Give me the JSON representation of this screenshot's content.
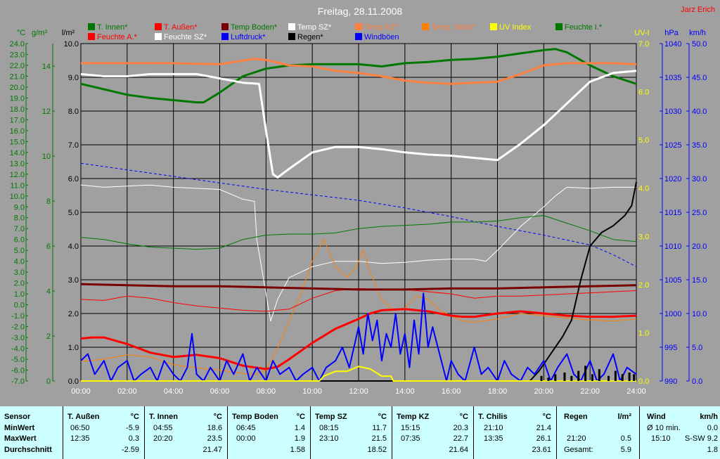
{
  "title": "Freitag, 28.11.2008",
  "author": "Jarz Erich",
  "legend": [
    {
      "label": "T. Innen*",
      "color": "#007800"
    },
    {
      "label": "T. Außen*",
      "color": "#ff0000"
    },
    {
      "label": "Temp Boden*",
      "color": "#780000"
    },
    {
      "label": "Temp SZ*",
      "color": "#ffffff"
    },
    {
      "label": "Temp KZ*",
      "color": "#ff8040"
    },
    {
      "label": "Temp. Wind*",
      "color": "#ff8000"
    },
    {
      "label": "UV Index",
      "color": "#ffff00"
    },
    {
      "label": "Feuchte I.*",
      "color": "#007800"
    },
    {
      "label": "Feuchte A.*",
      "color": "#ff0000"
    },
    {
      "label": "Feuchte SZ*",
      "color": "#ffffff"
    },
    {
      "label": "Luftdruck*",
      "color": "#0000ff"
    },
    {
      "label": "Regen*",
      "color": "#000000"
    },
    {
      "label": "Windböen",
      "color": "#0000ff"
    }
  ],
  "axis_units": {
    "temp": "°C",
    "hum": "g/m³",
    "rain": "l/m²",
    "uv": "UV-I",
    "pressure": "hPa",
    "wind": "km/h"
  },
  "chart_data": {
    "type": "line",
    "title": "Freitag, 28.11.2008",
    "x_ticks": [
      "00:00",
      "02:00",
      "04:00",
      "06:00",
      "08:00",
      "10:00",
      "12:00",
      "14:00",
      "16:00",
      "18:00",
      "20:00",
      "22:00",
      "24:00"
    ],
    "xlim": [
      0,
      24
    ],
    "axes": {
      "temp": {
        "ylim": [
          -7.0,
          24.0
        ],
        "ticks": [
          "24.0",
          "23.0",
          "22.0",
          "21.0",
          "20.0",
          "19.0",
          "18.0",
          "17.0",
          "16.0",
          "15.0",
          "14.0",
          "13.0",
          "12.0",
          "11.0",
          "10.0",
          "9.0",
          "8.0",
          "7.0",
          "6.0",
          "5.0",
          "4.0",
          "3.0",
          "2.0",
          "1.0",
          "0.0",
          "-1.0",
          "-2.0",
          "-3.0",
          "-4.0",
          "-5.0",
          "-6.0",
          "-7.0"
        ]
      },
      "humidity": {
        "ylim": [
          0,
          15
        ],
        "ticks": [
          "14",
          "12",
          "10",
          "8",
          "6",
          "4",
          "2",
          "0"
        ]
      },
      "rain": {
        "ylim": [
          0,
          10
        ],
        "ticks": [
          "10.0",
          "9.0",
          "8.0",
          "7.0",
          "6.0",
          "5.0",
          "4.0",
          "3.0",
          "2.0",
          "1.0",
          "0.0"
        ]
      },
      "uv": {
        "ylim": [
          0,
          7
        ],
        "ticks": [
          "7.0",
          "6.0",
          "5.0",
          "4.0",
          "3.0",
          "2.0",
          "1.0",
          "0.0"
        ]
      },
      "pressure": {
        "ylim": [
          990,
          1040
        ],
        "ticks": [
          "1040",
          "1035",
          "1030",
          "1025",
          "1020",
          "1015",
          "1010",
          "1005",
          "1000",
          "995",
          "990"
        ]
      },
      "wind": {
        "ylim": [
          0,
          50
        ],
        "ticks": [
          "50.0",
          "45.0",
          "40.0",
          "35.0",
          "30.0",
          "25.0",
          "20.0",
          "15.0",
          "10.0",
          "5.0",
          "0.0"
        ]
      }
    },
    "series": [
      {
        "name": "T. Innen*",
        "axis": "temp",
        "color": "#007800",
        "width": 3,
        "x": [
          0,
          1,
          2,
          3,
          4,
          5,
          5.3,
          6,
          7,
          8,
          9,
          10,
          11,
          12,
          13,
          14,
          15,
          16,
          17,
          18,
          19,
          20,
          20.5,
          21,
          22,
          23,
          24
        ],
        "y": [
          20.3,
          19.8,
          19.3,
          19.0,
          18.8,
          18.6,
          18.6,
          19.5,
          21.0,
          21.7,
          22.0,
          22.1,
          22.1,
          22.1,
          21.9,
          22.2,
          22.3,
          22.5,
          22.6,
          22.8,
          23.1,
          23.4,
          23.5,
          23.2,
          22.0,
          21.0,
          20.3
        ]
      },
      {
        "name": "Temp KZ*",
        "axis": "temp",
        "color": "#ff8040",
        "width": 3,
        "x": [
          0,
          2,
          4,
          6,
          7.5,
          8,
          9,
          10,
          11,
          12,
          13,
          14,
          15,
          16,
          17,
          18,
          19,
          20,
          21,
          22,
          23,
          24
        ],
        "y": [
          22.2,
          22.2,
          22.2,
          22.1,
          22.6,
          22.5,
          22.0,
          21.9,
          21.5,
          21.3,
          21.0,
          20.6,
          20.4,
          20.3,
          20.4,
          20.5,
          21.2,
          22.0,
          22.2,
          22.2,
          22.2,
          22.1
        ]
      },
      {
        "name": "Temp SZ*",
        "axis": "temp",
        "color": "#ffffff",
        "width": 3,
        "x": [
          0,
          1,
          2,
          3,
          4,
          5,
          6,
          7,
          7.7,
          8,
          8.3,
          8.5,
          9,
          10,
          11,
          12,
          13,
          14,
          15,
          16,
          17,
          18,
          19,
          20,
          21,
          22,
          23,
          24
        ],
        "y": [
          21.2,
          21.0,
          21.0,
          21.2,
          21.2,
          21.2,
          20.8,
          20.4,
          20.3,
          16.0,
          12.0,
          11.7,
          12.5,
          14.0,
          14.5,
          14.5,
          14.3,
          14.0,
          13.8,
          13.7,
          13.5,
          13.3,
          14.8,
          16.5,
          18.5,
          20.5,
          21.3,
          21.5
        ]
      },
      {
        "name": "Feuchte SZ*",
        "axis": "temp",
        "color": "#ffffff",
        "width": 1,
        "x": [
          0,
          1,
          2,
          3,
          4,
          5,
          6,
          7,
          7.5,
          7.6,
          8,
          8.2,
          8.5,
          9,
          10,
          11,
          12,
          13,
          14,
          15,
          16,
          17,
          17.5,
          18,
          19,
          20,
          20.5,
          21,
          22,
          23,
          24
        ],
        "y": [
          11.0,
          10.8,
          10.9,
          11.0,
          10.8,
          10.7,
          10.6,
          9.7,
          9.5,
          6.0,
          1.0,
          -1.5,
          0.5,
          2.5,
          3.5,
          4.0,
          4.0,
          3.8,
          3.9,
          4.1,
          4.2,
          4.2,
          4.0,
          5.0,
          7.2,
          9.0,
          10.0,
          10.8,
          10.7,
          10.8,
          10.8
        ]
      },
      {
        "name": "Luftdruck*",
        "axis": "temp",
        "color": "#0000ff",
        "width": 1,
        "dash": "4,3",
        "x": [
          0,
          2,
          4,
          6,
          8,
          10,
          12,
          14,
          16,
          18,
          20,
          22,
          23,
          24
        ],
        "y": [
          13.0,
          12.4,
          11.8,
          11.2,
          10.6,
          10.1,
          9.6,
          8.9,
          8.1,
          7.2,
          6.4,
          5.5,
          4.6,
          3.5
        ]
      },
      {
        "name": "Feuchte I.*",
        "axis": "temp",
        "color": "#007800",
        "width": 1,
        "x": [
          0,
          1,
          2,
          3,
          4,
          5,
          6,
          7,
          8,
          9,
          10,
          11,
          12,
          13,
          14,
          15,
          16,
          17,
          18,
          19,
          20,
          21,
          22,
          23,
          24
        ],
        "y": [
          6.2,
          6.0,
          5.6,
          5.3,
          5.2,
          5.1,
          5.2,
          6.0,
          6.4,
          6.5,
          6.5,
          6.6,
          7.0,
          7.2,
          7.3,
          7.4,
          7.6,
          7.6,
          7.7,
          8.0,
          8.2,
          7.5,
          6.8,
          6.0,
          5.8
        ]
      },
      {
        "name": "Temp. Wind*",
        "axis": "temp",
        "color": "#ff8000",
        "width": 1,
        "x": [
          0,
          1,
          2,
          3,
          4,
          5,
          6,
          7,
          7.5,
          8,
          8.5,
          9,
          9.5,
          10,
          10.5,
          11,
          11.5,
          11.9,
          12.2,
          12.5,
          13,
          13.5,
          14,
          14.5,
          15,
          15.5,
          16,
          16.5,
          17,
          18,
          19,
          20,
          21,
          22,
          23,
          24
        ],
        "y": [
          -5.2,
          -5.0,
          -4.6,
          -4.8,
          -5.5,
          -5.8,
          -6.0,
          -6.3,
          -6.4,
          -6.0,
          -4.0,
          -1.5,
          1.0,
          4.0,
          6.0,
          3.5,
          2.5,
          3.5,
          5.0,
          3.0,
          0.5,
          -0.5,
          -0.3,
          0.8,
          0.5,
          -0.5,
          -1.0,
          -1.5,
          -1.6,
          -1.3,
          -0.8,
          -1.0,
          -1.2,
          -1.4,
          -1.5,
          -1.3
        ]
      },
      {
        "name": "Feuchte A.*",
        "axis": "temp",
        "color": "#ff0000",
        "width": 1,
        "x": [
          0,
          1,
          2,
          3,
          4,
          5,
          6,
          7,
          8,
          9,
          10,
          11,
          12,
          13,
          14,
          15,
          16,
          17,
          18,
          19,
          20,
          21,
          22,
          23,
          24
        ],
        "y": [
          0.5,
          0.4,
          0.8,
          0.6,
          0.2,
          -0.1,
          -0.3,
          -0.5,
          -0.6,
          -0.4,
          0.6,
          1.3,
          1.5,
          1.4,
          1.4,
          1.2,
          1.0,
          0.6,
          0.8,
          0.8,
          0.9,
          1.0,
          1.1,
          1.2,
          1.3
        ]
      },
      {
        "name": "T. Außen*",
        "axis": "temp",
        "color": "#ff0000",
        "width": 3,
        "x": [
          0,
          0.5,
          1,
          2,
          3,
          4,
          5,
          6,
          7,
          8,
          8.5,
          9,
          10,
          11,
          12,
          12.5,
          13,
          14,
          15,
          16,
          16.5,
          17,
          18,
          19,
          20,
          21,
          22,
          23,
          24
        ],
        "y": [
          -3.1,
          -3.0,
          -3.0,
          -3.6,
          -4.4,
          -4.8,
          -4.6,
          -4.9,
          -5.6,
          -5.9,
          -5.7,
          -5.0,
          -3.5,
          -2.2,
          -1.3,
          -0.8,
          -0.5,
          -0.4,
          -0.6,
          -1.0,
          -1.1,
          -1.1,
          -0.8,
          -0.6,
          -0.8,
          -1.0,
          -1.1,
          -1.1,
          -1.0
        ]
      },
      {
        "name": "Temp Boden*",
        "axis": "temp",
        "color": "#780000",
        "width": 3,
        "x": [
          0,
          2,
          4,
          6,
          8,
          10,
          12,
          14,
          16,
          18,
          20,
          22,
          24
        ],
        "y": [
          1.9,
          1.8,
          1.7,
          1.7,
          1.6,
          1.5,
          1.4,
          1.4,
          1.5,
          1.5,
          1.6,
          1.7,
          1.8
        ]
      },
      {
        "name": "Regen*",
        "axis": "rain",
        "color": "#000000",
        "width": 2,
        "x": [
          0,
          19.4,
          19.8,
          20.3,
          20.8,
          21.2,
          21.6,
          22.0,
          22.5,
          23.0,
          23.5,
          23.8,
          24
        ],
        "y": [
          0,
          0,
          0.3,
          0.8,
          1.3,
          1.8,
          3.0,
          4.0,
          4.4,
          4.6,
          4.9,
          5.2,
          5.9
        ]
      },
      {
        "name": "Windböen",
        "axis": "wind",
        "color": "#0000ff",
        "width": 2,
        "x": [
          0,
          0.3,
          0.6,
          1,
          1.3,
          1.6,
          2,
          2.3,
          2.6,
          3,
          3.3,
          3.6,
          4,
          4.3,
          4.6,
          4.8,
          5,
          5.3,
          5.6,
          6,
          6.3,
          6.6,
          7,
          7.3,
          7.6,
          8,
          8.3,
          8.6,
          9,
          9.3,
          9.6,
          10,
          10.3,
          10.6,
          11,
          11.3,
          11.6,
          12,
          12.2,
          12.4,
          12.6,
          12.8,
          13,
          13.2,
          13.4,
          13.6,
          13.8,
          14,
          14.2,
          14.4,
          14.6,
          14.8,
          15,
          15.2,
          15.5,
          15.8,
          16,
          16.3,
          16.6,
          17,
          17.3,
          17.6,
          18,
          18.3,
          18.6,
          19,
          19.3,
          19.6,
          20,
          20.3,
          20.6,
          21,
          21.3,
          21.6,
          22,
          22.3,
          22.6,
          23,
          23.3,
          23.6,
          24
        ],
        "y": [
          3,
          4,
          1,
          3,
          0,
          2,
          3,
          0,
          1,
          2,
          0,
          3,
          1,
          0,
          2,
          7,
          1,
          0,
          2,
          0,
          3,
          1,
          4,
          0,
          2,
          0,
          3,
          1,
          2,
          0,
          1,
          2,
          0,
          2,
          3,
          5,
          2,
          8,
          4,
          10,
          6,
          9,
          3,
          7,
          5,
          10,
          4,
          7,
          2,
          9,
          4,
          13,
          5,
          8,
          4,
          0,
          3,
          1,
          0,
          5,
          1,
          2,
          0,
          3,
          1,
          0,
          2,
          1,
          3,
          0,
          2,
          4,
          1,
          0,
          3,
          0,
          1,
          4,
          0,
          2,
          1
        ]
      },
      {
        "name": "UV Index",
        "axis": "uv",
        "color": "#ffff00",
        "width": 2,
        "x": [
          0,
          10.3,
          10.5,
          11,
          11.5,
          12,
          12.5,
          13,
          13.4,
          13.5,
          24
        ],
        "y": [
          0,
          0,
          0.1,
          0.2,
          0.2,
          0.3,
          0.25,
          0.1,
          0.1,
          0,
          0
        ]
      }
    ],
    "rain_bars": {
      "axis": "rain",
      "color": "#000000",
      "x": [
        19.9,
        20.2,
        20.5,
        20.9,
        21.2,
        21.5,
        21.8,
        22.1,
        22.4,
        22.8,
        23.1,
        23.4,
        23.7,
        23.9
      ],
      "y": [
        0.15,
        0.1,
        0.2,
        0.25,
        0.15,
        0.3,
        0.45,
        0.2,
        0.35,
        0.15,
        0.3,
        0.2,
        0.25,
        0.2
      ]
    }
  },
  "stats": {
    "row_labels": {
      "sensor": "Sensor",
      "min": "MinWert",
      "max": "MaxWert",
      "avg": "Durchschnitt"
    },
    "columns": [
      {
        "name": "T. Außen",
        "unit": "°C",
        "min_time": "06:50",
        "min_val": "-5.9",
        "max_time": "12:35",
        "max_val": "0.3",
        "avg": "-2.59"
      },
      {
        "name": "T. Innen",
        "unit": "°C",
        "min_time": "04:55",
        "min_val": "18.6",
        "max_time": "20:20",
        "max_val": "23.5",
        "avg": "21.47"
      },
      {
        "name": "Temp Boden",
        "unit": "°C",
        "min_time": "06:45",
        "min_val": "1.4",
        "max_time": "00:00",
        "max_val": "1.9",
        "avg": "1.58"
      },
      {
        "name": "Temp SZ",
        "unit": "°C",
        "min_time": "08:15",
        "min_val": "11.7",
        "max_time": "23:10",
        "max_val": "21.5",
        "avg": "18.52"
      },
      {
        "name": "Temp KZ",
        "unit": "°C",
        "min_time": "15:15",
        "min_val": "20.3",
        "max_time": "07:35",
        "max_val": "22.7",
        "avg": "21.64"
      },
      {
        "name": "T. Chilis",
        "unit": "°C",
        "min_time": "21:10",
        "min_val": "21.4",
        "max_time": "13:35",
        "max_val": "26.1",
        "avg": "23.61"
      }
    ],
    "regen": {
      "name": "Regen",
      "unit": "l/m²",
      "max_time": "21:20",
      "max_val": "0.5",
      "total_label": "Gesamt:",
      "total_val": "5.9"
    },
    "wind": {
      "name": "Wind",
      "unit": "km/h",
      "avg_label": "Ø 10 min.",
      "avg_val": "0.0",
      "max_time": "15:10",
      "max_val": "S-SW 9.2",
      "avg2": "1.8"
    }
  }
}
